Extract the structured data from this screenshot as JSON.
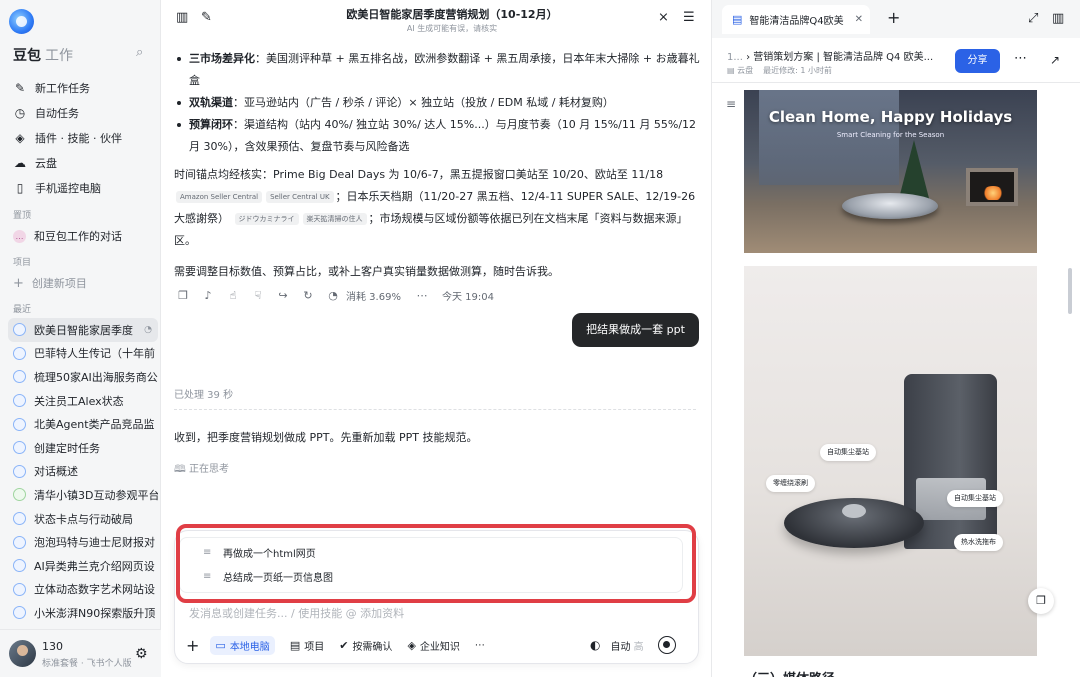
{
  "sidebar": {
    "brand": "豆包",
    "brand_sub": "工作",
    "nav": [
      {
        "label": "新工作任务",
        "icon": "edit-icon"
      },
      {
        "label": "自动任务",
        "icon": "clock-icon"
      },
      {
        "label": "插件 · 技能 · 伙伴",
        "icon": "layers-icon"
      },
      {
        "label": "云盘",
        "icon": "cloud-icon"
      },
      {
        "label": "手机遥控电脑",
        "icon": "phone-icon"
      }
    ],
    "pinned_title": "置顶",
    "pinned_item": "和豆包工作的对话",
    "projects_title": "项目",
    "new_project": "创建新项目",
    "recent_title": "最近",
    "recent": [
      "欧美日智能家居季度",
      "巴菲特人生传记（十年前",
      "梳理50家AI出海服务商公",
      "关注员工Alex状态",
      "北美Agent类产品竞品监",
      "创建定时任务",
      "对话概述",
      "清华小镇3D互动参观平台",
      "状态卡点与行动破局",
      "泡泡玛特与迪士尼财报对",
      "AI异类弗兰克介绍网页设",
      "立体动态数字艺术网站设",
      "小米澎湃N90探索版升顶"
    ],
    "user_name": "130",
    "user_plan": "标准套餐 · 飞书个人版"
  },
  "chat": {
    "title": "欧美日智能家居季度营销规划（10-12月）",
    "subtitle": "AI 生成可能有误，请核实",
    "bullets": [
      {
        "bold": "三市场差异化",
        "text": "：美国测评种草 + 黑五排名战，欧洲参数翻译 + 黑五周承接，日本年末大掃除 + お歳暮礼盒"
      },
      {
        "bold": "双轨渠道",
        "text": "：亚马逊站内（广告 / 秒杀 / 评论）× 独立站（投放 / EDM 私域 / 耗材复购）"
      },
      {
        "bold": "预算闭环",
        "text": "：渠道结构（站内 40%/ 独立站 30%/ 达人 15%...）与月度节奏（10 月 15%/11 月 55%/12 月 30%），含效果预估、复盘节奏与风险备选"
      }
    ],
    "p_anchor_1": "时间锚点均经核实：Prime Big Deal Days 为 10/6-7，黑五提报窗口美站至 10/20、欧站至 11/18",
    "tag_1": "Amazon Seller Central",
    "tag_2": "Seller Central UK",
    "p_anchor_2": "；日本乐天档期（11/20-27 黑五档、12/4-11 SUPER SALE、12/19-26 大感謝祭）",
    "tag_3": "ジドウカミナライ",
    "tag_4": "楽天拡清掃の住人",
    "p_anchor_3": "；市场规模与区域份额等依据已列在文档末尾「资料与数据来源」区。",
    "p_end": "需要调整目标数值、预算占比，或补上客户真实销量数据做测算，随时告诉我。",
    "cost": "消耗 3.69%",
    "time": "今天 19:04",
    "user_msg": "把结果做成一套 ppt",
    "processed": "已处理 39 秒",
    "reply": "收到，把季度营销规划做成 PPT。先重新加载 PPT 技能规范。",
    "thinking": "正在思考",
    "suggestions": [
      "再做成一个html网页",
      "总结成一页纸一页信息图"
    ],
    "placeholder": "发消息或创建任务... / 使用技能 @ 添加资料",
    "tools": [
      "本地电脑",
      "项目",
      "按需确认",
      "企业知识"
    ],
    "mode": "自动",
    "mode_level": "高"
  },
  "panel": {
    "tab_title": "智能清洁品牌Q4欧美",
    "crumb_prefix": "1...",
    "crumb": "营销策划方案 | 智能清洁品牌 Q4 欧美...",
    "location": "云盘",
    "modified": "最近修改: 1 小时前",
    "share": "分享",
    "img1_title": "Clean Home, Happy Holidays",
    "img1_sub": "Smart Cleaning for the Season",
    "labels": [
      "自动集尘基站",
      "零缠绕滚刷",
      "自动集尘基站",
      "热水洗拖布"
    ],
    "bottom_heading": "（三）媒体路径"
  }
}
